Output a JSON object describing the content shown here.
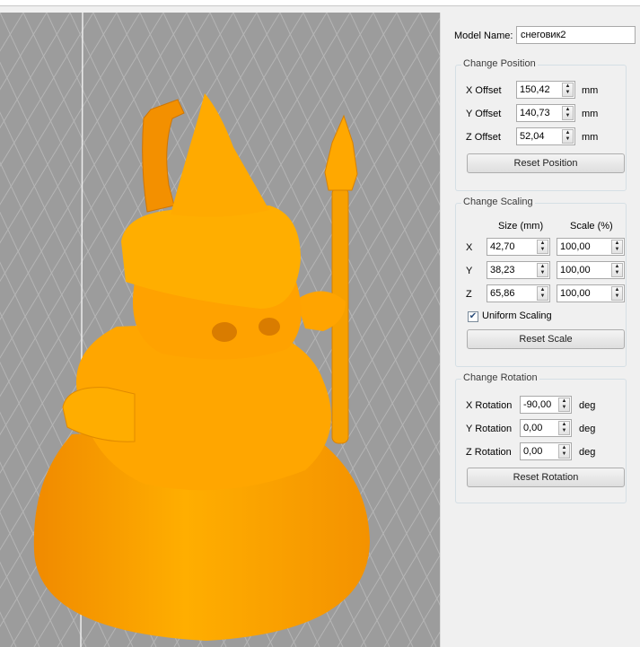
{
  "colors": {
    "model": "#ffa500",
    "grid_bg": "#9c9c9c",
    "grid_line": "#b7b7b7"
  },
  "model": {
    "name_label": "Model Name:",
    "name_value": "снеговик2"
  },
  "position": {
    "title": "Change Position",
    "rows": [
      {
        "label": "X Offset",
        "value": "150,42",
        "unit": "mm"
      },
      {
        "label": "Y Offset",
        "value": "140,73",
        "unit": "mm"
      },
      {
        "label": "Z Offset",
        "value": "52,04",
        "unit": "mm"
      }
    ],
    "reset_label": "Reset Position"
  },
  "scaling": {
    "title": "Change Scaling",
    "size_header": "Size (mm)",
    "scale_header": "Scale (%)",
    "rows": [
      {
        "axis": "X",
        "size": "42,70",
        "scale": "100,00"
      },
      {
        "axis": "Y",
        "size": "38,23",
        "scale": "100,00"
      },
      {
        "axis": "Z",
        "size": "65,86",
        "scale": "100,00"
      }
    ],
    "uniform_label": "Uniform Scaling",
    "uniform_checked": true,
    "reset_label": "Reset Scale"
  },
  "rotation": {
    "title": "Change Rotation",
    "rows": [
      {
        "label": "X Rotation",
        "value": "-90,00",
        "unit": "deg"
      },
      {
        "label": "Y Rotation",
        "value": "0,00",
        "unit": "deg"
      },
      {
        "label": "Z Rotation",
        "value": "0,00",
        "unit": "deg"
      }
    ],
    "reset_label": "Reset Rotation"
  }
}
